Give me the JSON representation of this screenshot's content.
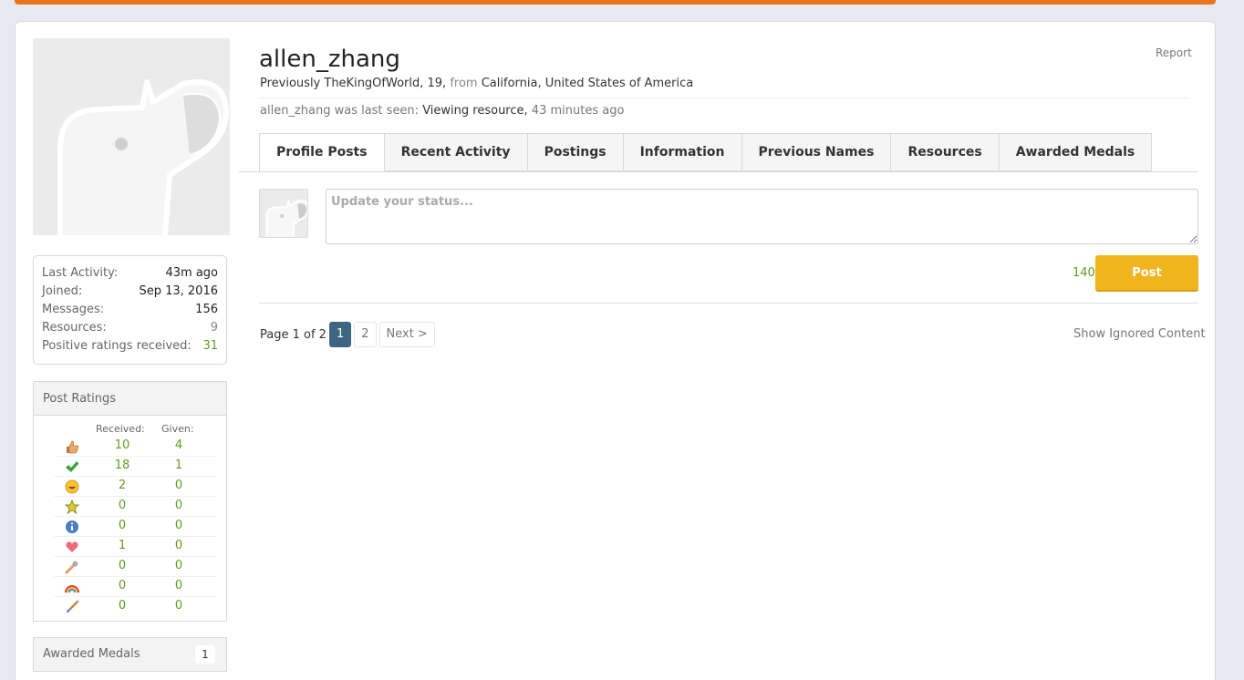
{
  "profile": {
    "username": "allen_zhang",
    "report_label": "Report",
    "previously_label": "Previously TheKingOfWorld, 19,",
    "from_label": "from",
    "location": "California, United States of America",
    "last_seen_prefix": "allen_zhang was last seen:",
    "last_seen_activity": "Viewing resource,",
    "last_seen_time": "43 minutes ago"
  },
  "stats": [
    {
      "label": "Last Activity:",
      "value": "43m ago"
    },
    {
      "label": "Joined:",
      "value": "Sep 13, 2016"
    },
    {
      "label": "Messages:",
      "value": "156"
    },
    {
      "label": "Resources:",
      "value": "9"
    },
    {
      "label": "Positive ratings received:",
      "value": "31"
    }
  ],
  "ratings": {
    "title": "Post Ratings",
    "received_label": "Received:",
    "given_label": "Given:",
    "rows": [
      {
        "icon": "thumbs-up-icon",
        "received": "10",
        "given": "4"
      },
      {
        "icon": "checkmark-icon",
        "received": "18",
        "given": "1"
      },
      {
        "icon": "funny-face-icon",
        "received": "2",
        "given": "0"
      },
      {
        "icon": "star-medal-icon",
        "received": "0",
        "given": "0"
      },
      {
        "icon": "info-icon",
        "received": "0",
        "given": "0"
      },
      {
        "icon": "heart-icon",
        "received": "1",
        "given": "0"
      },
      {
        "icon": "wrench-icon",
        "received": "0",
        "given": "0"
      },
      {
        "icon": "rainbow-icon",
        "received": "0",
        "given": "0"
      },
      {
        "icon": "paintbrush-icon",
        "received": "0",
        "given": "0"
      }
    ]
  },
  "medals": {
    "label": "Awarded Medals",
    "count": "1"
  },
  "tabs": [
    "Profile Posts",
    "Recent Activity",
    "Postings",
    "Information",
    "Previous Names",
    "Resources",
    "Awarded Medals"
  ],
  "status": {
    "placeholder": "Update your status...",
    "char_count": "140",
    "post_label": "Post"
  },
  "pager": {
    "text": "Page 1 of 2",
    "pages": [
      "1",
      "2"
    ],
    "next": "Next >"
  },
  "show_ignored": "Show Ignored Content",
  "colors": {
    "accent": "#e8761c",
    "post_button": "#f0b51e",
    "positive": "#5c9e1e",
    "page_active": "#3d6680"
  }
}
